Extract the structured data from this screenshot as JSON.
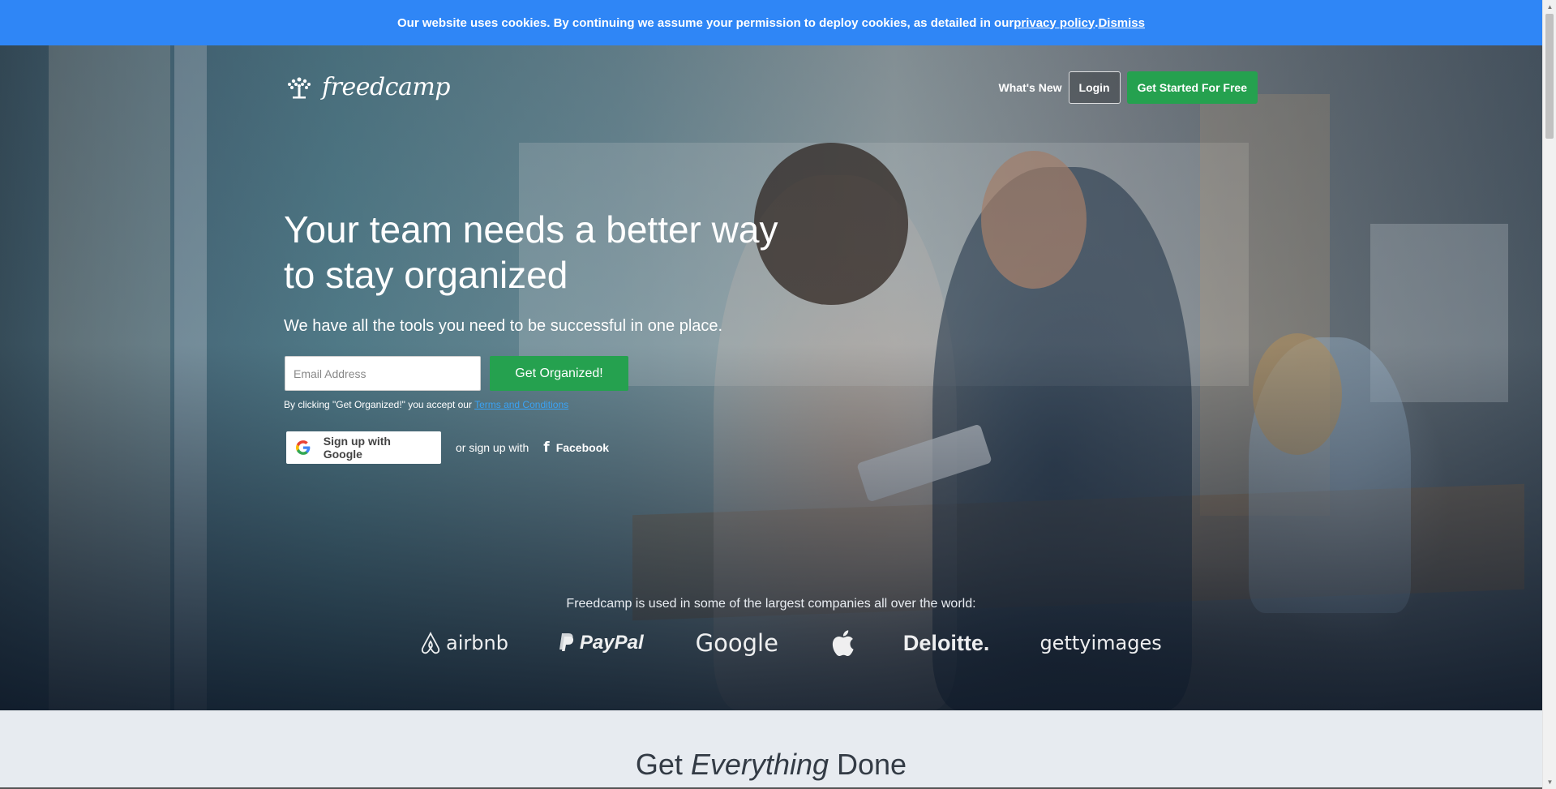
{
  "cookie_bar": {
    "text": "Our website uses cookies. By continuing we assume your permission to deploy cookies, as detailed in our ",
    "policy_link": "privacy policy",
    "separator": ". ",
    "dismiss": "Dismiss"
  },
  "header": {
    "logo_text": "freedcamp",
    "nav": {
      "whats_new": "What's New",
      "login": "Login",
      "get_started": "Get Started For Free"
    }
  },
  "hero": {
    "headline": "Your team needs a better way to stay organized",
    "subhead": "We have all the tools you need to be successful in one place.",
    "email_placeholder": "Email Address",
    "cta": "Get Organized!",
    "terms_prefix": "By clicking \"Get Organized!\" you accept our ",
    "terms_link": "Terms and Conditions",
    "google_button": "Sign up with Google",
    "or_text": "or sign up with",
    "facebook_button": "Facebook",
    "facebook_icon": "f"
  },
  "clients": {
    "caption": "Freedcamp is used in some of the largest companies all over the world:",
    "logos": {
      "airbnb": "airbnb",
      "paypal": "PayPal",
      "google": "Google",
      "deloitte": "Deloitte.",
      "getty": "gettyimages"
    }
  },
  "section": {
    "title_start": "Get ",
    "title_emphasis": "Everything",
    "title_end": " Done"
  },
  "colors": {
    "cookie_bar": "#2f86f6",
    "green": "#25a14f",
    "terms_link": "#3aa3f5",
    "page_bg": "#e7ebf0"
  },
  "icons": [
    "freedcamp-tree-icon",
    "google-g-icon",
    "facebook-f-icon",
    "airbnb-icon",
    "paypal-p-icon",
    "apple-icon"
  ]
}
